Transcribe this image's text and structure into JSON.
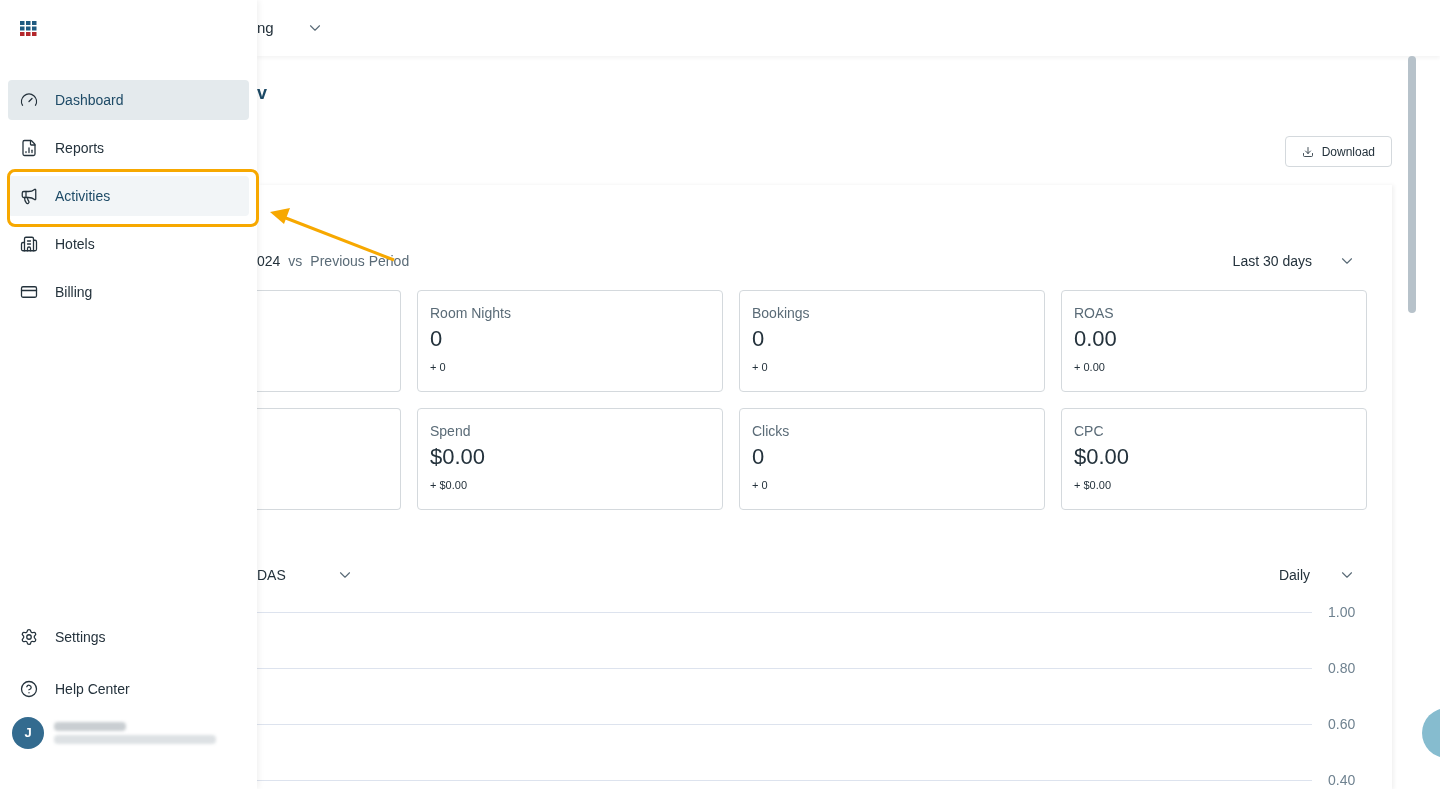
{
  "sidebar": {
    "items": [
      {
        "kind": "gauge",
        "label": "Dashboard",
        "selected": true,
        "hovered": false
      },
      {
        "kind": "report",
        "label": "Reports",
        "selected": false,
        "hovered": false
      },
      {
        "kind": "megaphone",
        "label": "Activities",
        "selected": false,
        "hovered": true
      },
      {
        "kind": "building",
        "label": "Hotels",
        "selected": false,
        "hovered": false
      },
      {
        "kind": "card",
        "label": "Billing",
        "selected": false,
        "hovered": false
      }
    ],
    "footer_items": [
      {
        "kind": "gear",
        "label": "Settings"
      },
      {
        "kind": "help",
        "label": "Help Center"
      }
    ],
    "user": {
      "initial": "J"
    }
  },
  "top_bar": {
    "selector_text": "ng"
  },
  "page": {
    "title": "v",
    "download_button": "Download",
    "comparison": {
      "period": "024",
      "vs": "vs",
      "baseline": "Previous Period"
    },
    "range": "Last 30 days",
    "metrics": [
      {
        "label": "Room Nights",
        "value": "0",
        "delta": "+ 0"
      },
      {
        "label": "Bookings",
        "value": "0",
        "delta": "+ 0"
      },
      {
        "label": "ROAS",
        "value": "0.00",
        "delta": "+ 0.00"
      },
      {
        "label": "Spend",
        "value": "$0.00",
        "delta": "+ $0.00"
      },
      {
        "label": "Clicks",
        "value": "0",
        "delta": "+ 0"
      },
      {
        "label": "CPC",
        "value": "$0.00",
        "delta": "+ $0.00"
      }
    ],
    "chart_metric": "DAS",
    "interval": "Daily",
    "y_axis_labels": [
      "1.00",
      "0.80",
      "0.60",
      "0.40"
    ]
  }
}
